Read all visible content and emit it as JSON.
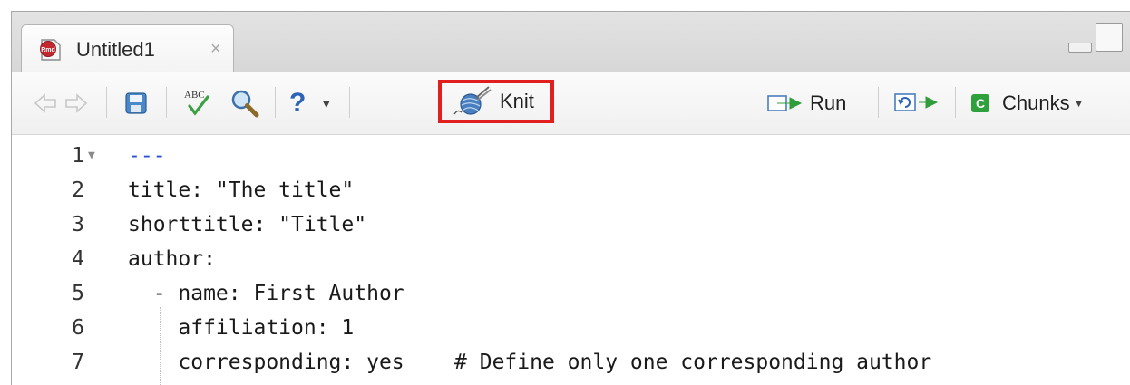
{
  "tab": {
    "title": "Untitled1",
    "close_glyph": "×"
  },
  "toolbar": {
    "help_glyph": "?",
    "knit_label": "Knit",
    "run_label": "Run",
    "chunks_label": "Chunks",
    "chunks_badge": "C",
    "spell_label": "ABC"
  },
  "editor": {
    "lines": [
      {
        "num": "1",
        "text": "---",
        "fold": true,
        "kind": "delim"
      },
      {
        "num": "2",
        "text": "title: \"The title\""
      },
      {
        "num": "3",
        "text": "shorttitle: \"Title\""
      },
      {
        "num": "4",
        "text": "author:"
      },
      {
        "num": "5",
        "text": "  - name: First Author"
      },
      {
        "num": "6",
        "text": "    affiliation: 1"
      },
      {
        "num": "7",
        "text": "    corresponding: yes    # Define only one corresponding author"
      }
    ]
  },
  "colors": {
    "highlight_box": "#e21f1f",
    "yaml_delimiter": "#2a4fd8",
    "chunks_green": "#2ea03c"
  },
  "icons": [
    "rmarkdown-file-icon",
    "back-arrow-icon",
    "forward-arrow-icon",
    "save-icon",
    "spellcheck-icon",
    "search-icon",
    "help-icon",
    "knit-yarn-icon",
    "run-arrow-icon",
    "rerun-icon",
    "chunks-icon"
  ]
}
